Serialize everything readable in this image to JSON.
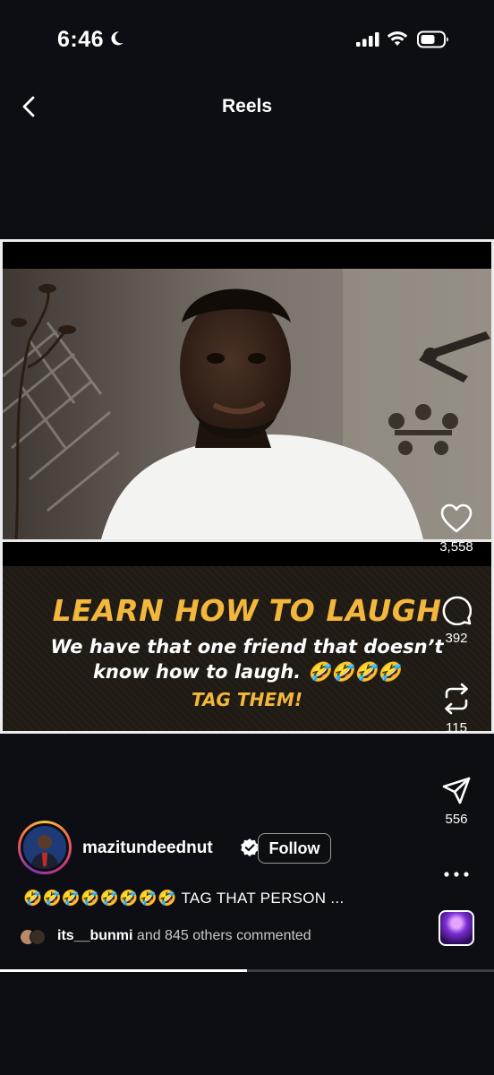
{
  "status_bar": {
    "time": "6:46",
    "icons": [
      "moon-icon",
      "signal-icon",
      "wifi-icon",
      "battery-icon"
    ]
  },
  "header": {
    "title": "Reels",
    "back_icon": "chevron-left-icon"
  },
  "video": {
    "caption_title": "LEARN HOW TO LAUGH",
    "caption_line_1": "We have that one friend that doesn’t",
    "caption_line_2": "know how to laugh. 🤣🤣🤣🤣",
    "caption_tag": "TAG THEM!",
    "accent_color": "#f2b73c"
  },
  "actions": {
    "likes": "3,558",
    "comments": "392",
    "remixes": "115",
    "shares": "556"
  },
  "author": {
    "username": "mazitundeednut",
    "follow_label": "Follow",
    "verified": true
  },
  "post": {
    "caption": "🤣🤣🤣🤣🤣🤣🤣🤣 TAG THAT PERSON ..."
  },
  "comments_summary": {
    "user": "its__bunmi",
    "rest": " and 845 others commented"
  },
  "playback": {
    "progress": 0.5
  }
}
